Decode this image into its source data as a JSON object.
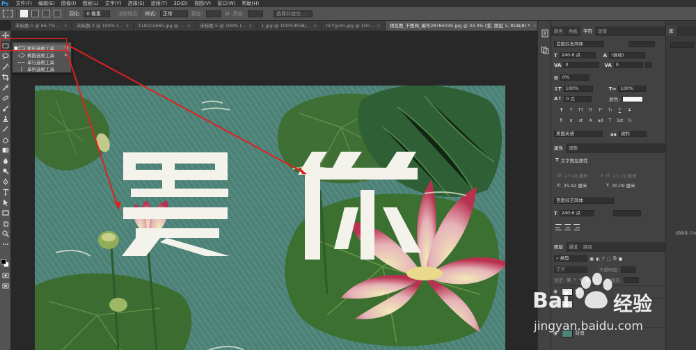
{
  "menu": {
    "logo": "Ps",
    "items": [
      "文件(F)",
      "编辑(E)",
      "图像(I)",
      "图层(L)",
      "文字(Y)",
      "选择(S)",
      "滤镜(T)",
      "3D(D)",
      "视图(V)",
      "窗口(W)",
      "帮助(H)"
    ]
  },
  "options": {
    "feather_label": "羽化:",
    "feather_value": "0 像素",
    "antialias": "消除锯齿",
    "style_label": "样式:",
    "style_value": "正常",
    "width_label": "宽度:",
    "height_label": "高度:",
    "select_mask": "选择并遮住..."
  },
  "tabs": [
    {
      "label": "未标题-1 @ 66.7% ...",
      "close": "×"
    },
    {
      "label": "未标题-2 @ 100% (...",
      "close": "×"
    },
    {
      "label": "118102665.jpg @ ...",
      "close": "×"
    },
    {
      "label": "未标题-5 @ 100% (...",
      "close": "×"
    },
    {
      "label": "1.jpg @ 100%(RGB/...",
      "close": "×"
    },
    {
      "label": "miYjyzm.jpg @ 100...",
      "close": "×"
    },
    {
      "label": "预览图_千图网_编号28765035.jpg @ 33.3% (爱, 图层 1, RGB/8) *",
      "close": "×"
    }
  ],
  "flyout": {
    "items": [
      {
        "label": "矩形选框工具",
        "key": "M",
        "selected": true
      },
      {
        "label": "椭圆选框工具",
        "key": "M",
        "selected": false
      },
      {
        "label": "单行选框工具",
        "key": "",
        "selected": false
      },
      {
        "label": "单列选框工具",
        "key": "",
        "selected": false
      }
    ]
  },
  "char_panel": {
    "tabs": [
      "颜色",
      "色板",
      "字符",
      "段落"
    ],
    "font_family": "百度综艺简体",
    "font_size": "240.6 点",
    "leading": "(自动)",
    "kerning": "0",
    "tracking": "0",
    "tsume": "0%",
    "v_scale": "100%",
    "h_scale": "100%",
    "baseline": "0 点",
    "color_label": "颜色:",
    "color": "#f7f7f7",
    "style_buttons": [
      "T",
      "T",
      "TT",
      "Tr",
      "T¹",
      "T₁",
      "T",
      "T"
    ],
    "ot_buttons": [
      "fi",
      "σ",
      "st",
      "A",
      "ad",
      "T",
      "1st",
      "½"
    ],
    "language": "美国英语",
    "antialias": "锐利",
    "aa_label": "aa"
  },
  "props_panel": {
    "tabs": [
      "属性",
      "调整"
    ],
    "title": "文字图层属性",
    "w_label": "W:",
    "w_value": "27.48 厘米",
    "h_label": "H:",
    "h_value": "21.19 厘米",
    "x_label": "X:",
    "x_value": "25.92 厘米",
    "y_label": "Y:",
    "y_value": "30.09 厘米",
    "font_family": "百度综艺简体",
    "font_size": "240.6 点"
  },
  "layers_panel": {
    "tabs": [
      "图层",
      "通道",
      "路径"
    ],
    "filter": "类型",
    "blend": "正常",
    "opacity_label": "不透明度:",
    "lock_label": "锁定:",
    "fill_label": "填充:",
    "layers": [
      {
        "name": "爱",
        "visible": true
      },
      {
        "name": "",
        "visible": true
      },
      {
        "name": "背景",
        "visible": true
      }
    ]
  },
  "library": {
    "tab": "库",
    "footer": "初始化 Cre"
  },
  "artwork": {
    "char1": "爱",
    "char2": "你"
  },
  "watermark": {
    "brand_a": "Bai",
    "brand_b": "经验",
    "url": "jingyan.baidu.com"
  }
}
